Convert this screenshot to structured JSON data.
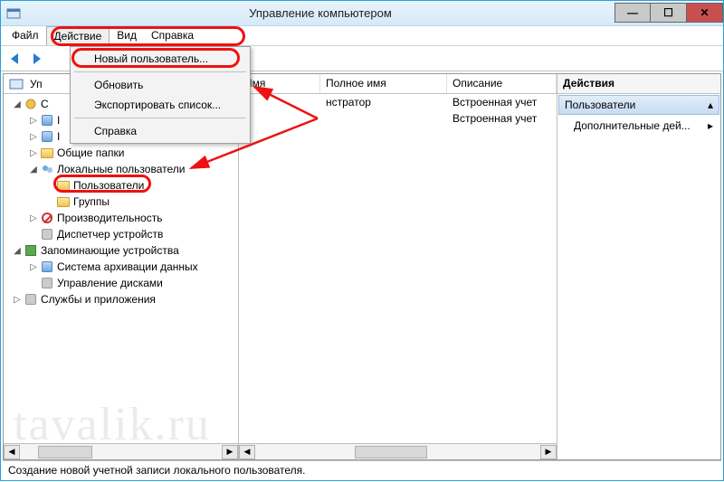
{
  "window": {
    "title": "Управление компьютером"
  },
  "menubar": {
    "file": "Файл",
    "action": "Действие",
    "view": "Вид",
    "help": "Справка"
  },
  "context_menu": {
    "new_user": "Новый пользователь...",
    "refresh": "Обновить",
    "export_list": "Экспортировать список...",
    "help": "Справка"
  },
  "tree": {
    "root_trunc": "Уп",
    "sys_trunc": "С",
    "scheduler_trunc": "I",
    "eventviewer_trunc": "I",
    "shared_folders": "Общие папки",
    "local_users": "Локальные пользовател",
    "local_users_suffix": "и",
    "users": "Пользователи",
    "groups": "Группы",
    "performance": "Производительность",
    "device_mgr": "Диспетчер устройств",
    "storage": "Запоминающие устройства",
    "backup": "Система архивации данных",
    "disk_mgmt": "Управление дисками",
    "services": "Службы и приложения"
  },
  "list": {
    "cols": {
      "name": "Имя",
      "fullname": "Полное имя",
      "desc": "Описание"
    },
    "rows": [
      {
        "name": "",
        "fullname": "нстратор",
        "desc": "Встроенная учет"
      },
      {
        "name": "",
        "fullname": "",
        "desc": "Встроенная учет"
      }
    ]
  },
  "actions": {
    "title": "Действия",
    "group": "Пользователи",
    "more": "Дополнительные дей..."
  },
  "status": "Создание новой учетной записи локального пользователя.",
  "watermark": "tavalik.ru"
}
